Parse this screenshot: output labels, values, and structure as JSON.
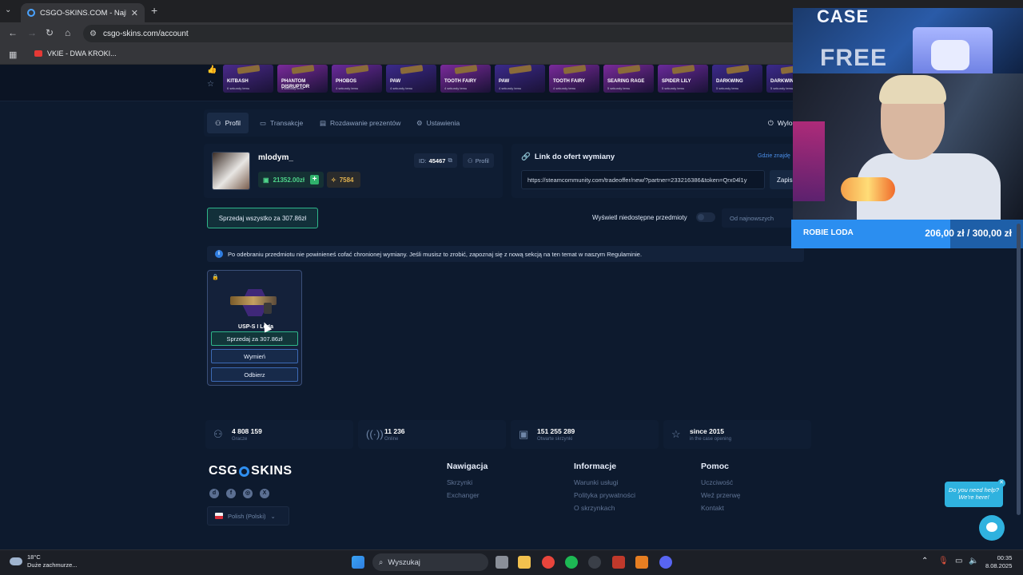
{
  "browser": {
    "tab_title": "CSGO-SKINS.COM - Najlepsze",
    "url": "csgo-skins.com/account",
    "bookmark": "VKIE - DWA KROKI..."
  },
  "strip": {
    "items": [
      {
        "name": "KITBASH",
        "sub": "6 sekundy temu",
        "color": "#4a2a8a"
      },
      {
        "name": "PHANTOM DISRUPTOR",
        "sub": "4 sekundy temu",
        "color": "#7a2a9a"
      },
      {
        "name": "PHOBOS",
        "sub": "4 sekundy temu",
        "color": "#6a2a9a"
      },
      {
        "name": "PAW",
        "sub": "4 sekundy temu",
        "color": "#3b2a8a"
      },
      {
        "name": "TOOTH FAIRY",
        "sub": "4 sekundy temu",
        "color": "#7a2a9a"
      },
      {
        "name": "PAW",
        "sub": "4 sekundy temu",
        "color": "#3b2a8a"
      },
      {
        "name": "TOOTH FAIRY",
        "sub": "4 sekundy temu",
        "color": "#7a2a9a"
      },
      {
        "name": "SEARING RAGE",
        "sub": "5 sekundy temu",
        "color": "#7a2a9a"
      },
      {
        "name": "SPIDER LILY",
        "sub": "5 sekundy temu",
        "color": "#6a2a9a"
      },
      {
        "name": "DARKWING",
        "sub": "5 sekundy temu",
        "color": "#3b2a8a"
      },
      {
        "name": "DARKWING",
        "sub": "5 sekundy temu",
        "color": "#3b2a8a"
      }
    ]
  },
  "profile_tabs": {
    "profil": "Profil",
    "transakcje": "Transakcje",
    "rozdawanie": "Rozdawanie prezentów",
    "ustawienia": "Ustawienia",
    "wyloguj": "Wylo"
  },
  "profile": {
    "username": "mlodym_",
    "balance": "21352.00zł",
    "coins": "7584",
    "id_label": "ID:",
    "id_value": "45467",
    "profile_button": "Profil"
  },
  "trade": {
    "title": "Link do ofert wymiany",
    "where": "Gdzie znajdę",
    "url": "https://steamcommunity.com/tradeoffer/new/?partner=233216386&token=Qrx04l1y",
    "save": "Zapis"
  },
  "controls": {
    "sell_all": "Sprzedaj wszystko za 307.86zł",
    "show_unavailable": "Wyświetl niedostępne przedmioty",
    "sort": "Od najnowszych"
  },
  "info": {
    "text": "Po odebraniu przedmiotu nie powinieneś cofać chronionej wymiany. Jeśli musisz to zrobić, zapoznaj się z nową sekcją na ten temat w naszym Regulaminie."
  },
  "item": {
    "name": "USP-S | Loda",
    "sell": "Sprzedaj za 307.86zł",
    "swap": "Wymień",
    "take": "Odbierz"
  },
  "stats": [
    {
      "value": "4 808 159",
      "label": "Gracze",
      "icon": "user-icon",
      "glyph": "⚇"
    },
    {
      "value": "11 236",
      "label": "Online",
      "icon": "broadcast-icon",
      "glyph": "((·))"
    },
    {
      "value": "151 255 289",
      "label": "Otwarte skrzynki",
      "icon": "box-icon",
      "glyph": "▣"
    },
    {
      "value": "since 2015",
      "label": "in the case opening",
      "icon": "star-icon",
      "glyph": "☆"
    }
  ],
  "footer": {
    "logo_left": "CSG",
    "logo_right": "SKINS",
    "language": "Polish (Polski)",
    "nav_title": "Nawigacja",
    "nav": [
      "Skrzynki",
      "Exchanger"
    ],
    "info_title": "Informacje",
    "info": [
      "Warunki usługi",
      "Polityka prywatności",
      "O skrzynkach"
    ],
    "help_title": "Pomoc",
    "help": [
      "Uczciwość",
      "Weź przerwę",
      "Kontakt"
    ]
  },
  "overlay": {
    "case": "CASE",
    "free": "FREE",
    "goal_label": "ROBIE LODA",
    "goal_value": "206,00 zł / 300,00 zł",
    "goal_progress": 0.6867
  },
  "chat": {
    "help_line1": "Do you need help?",
    "help_line2": "We're here!"
  },
  "taskbar": {
    "temp": "18°C",
    "weather": "Duże zachmurze...",
    "search": "Wyszukaj",
    "time": "00:35",
    "date": "8.08.2025"
  }
}
